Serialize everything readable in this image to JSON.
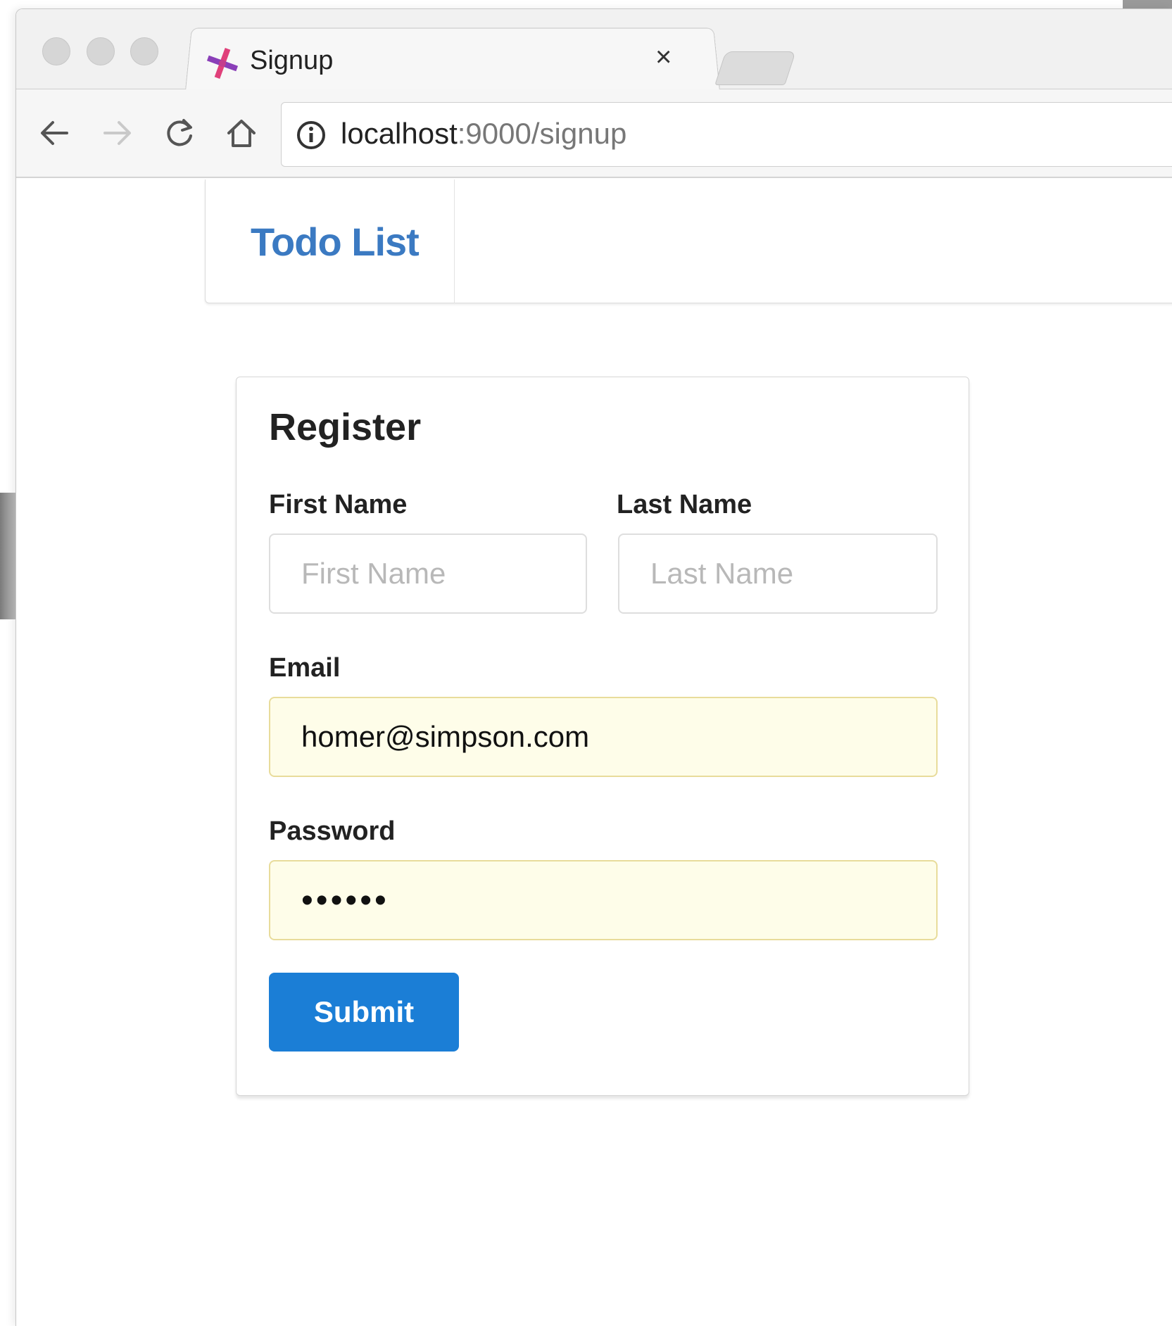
{
  "browser": {
    "tab_title": "Signup",
    "tab_close_glyph": "×",
    "favicon": "pinwheel-favicon",
    "url_host": "localhost",
    "url_rest": ":9000/signup",
    "icons": [
      "back-arrow-icon",
      "forward-arrow-icon",
      "reload-icon",
      "home-icon",
      "info-icon",
      "close-icon"
    ]
  },
  "navbar": {
    "brand": "Todo List"
  },
  "form": {
    "title": "Register",
    "first_name": {
      "label": "First Name",
      "placeholder": "First Name",
      "value": ""
    },
    "last_name": {
      "label": "Last Name",
      "placeholder": "Last Name",
      "value": ""
    },
    "email": {
      "label": "Email",
      "value": "homer@simpson.com"
    },
    "password": {
      "label": "Password",
      "value": "••••••"
    },
    "submit_label": "Submit"
  },
  "colors": {
    "brand_blue": "#3b7ac2",
    "submit_blue": "#1b7ed6",
    "autofill_yellow": "#fefde9"
  }
}
